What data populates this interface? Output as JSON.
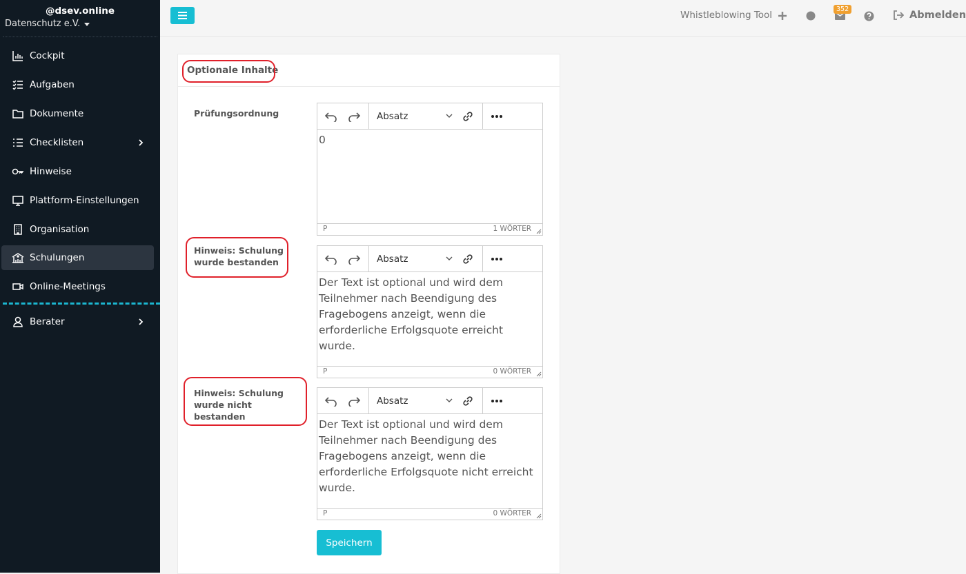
{
  "sidebar": {
    "brand": "@dsev.online",
    "org": "Datenschutz e.V.",
    "items": [
      {
        "label": "Cockpit"
      },
      {
        "label": "Aufgaben"
      },
      {
        "label": "Dokumente"
      },
      {
        "label": "Checklisten"
      },
      {
        "label": "Hinweise"
      },
      {
        "label": "Plattform-Einstellungen"
      },
      {
        "label": "Organisation"
      },
      {
        "label": "Schulungen",
        "active": true
      },
      {
        "label": "Online-Meetings"
      },
      {
        "label": "Berater"
      }
    ]
  },
  "topbar": {
    "tool": "Whistleblowing Tool",
    "badge": "352",
    "logout": "Abmelden"
  },
  "card": {
    "title": "Optionale Inhalte",
    "fields": [
      {
        "label": "Prüfungsordnung",
        "format": "Absatz",
        "content": "0",
        "status_tag": "P",
        "word_count": "1 WÖRTER"
      },
      {
        "label": "Hinweis: Schulung wurde bestanden",
        "format": "Absatz",
        "content": "Der Text ist optional und wird dem Teilnehmer nach Beendigung des Fragebogens anzeigt, wenn die erforderliche Erfolgsquote erreicht wurde.",
        "status_tag": "P",
        "word_count": "0 WÖRTER"
      },
      {
        "label": "Hinweis: Schulung wurde nicht bestanden",
        "format": "Absatz",
        "content": "Der Text ist optional und wird dem Teilnehmer nach Beendigung des Fragebogens anzeigt, wenn die erforderliche Erfolgsquote nicht erreicht wurde.",
        "status_tag": "P",
        "word_count": "0 WÖRTER"
      }
    ],
    "save_label": "Speichern"
  },
  "colors": {
    "sidebar_bg": "#101a23",
    "accent": "#17bed3",
    "annotation": "#e0202a",
    "badge": "#f0a030"
  }
}
